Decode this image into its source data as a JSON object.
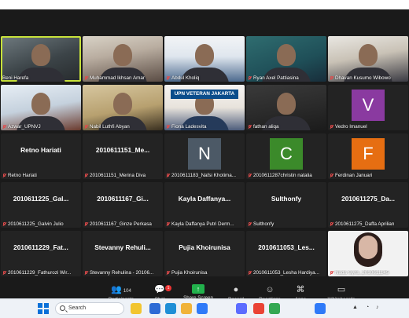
{
  "participants": [
    {
      "name": "Beni Harefa",
      "row": 0,
      "col": 0,
      "kind": "video",
      "style": "v1",
      "active": true,
      "muted": false
    },
    {
      "name": "Muhammad Ikhsan Amar",
      "row": 0,
      "col": 1,
      "kind": "video",
      "style": "v2",
      "muted": true
    },
    {
      "name": "Abdul Kholiq",
      "row": 0,
      "col": 2,
      "kind": "video",
      "style": "v3",
      "muted": true
    },
    {
      "name": "Ryan Axel Pattiasina",
      "row": 0,
      "col": 3,
      "kind": "video",
      "style": "v4",
      "muted": true
    },
    {
      "name": "Dhavan Kusumo Wibowo",
      "row": 0,
      "col": 4,
      "kind": "video",
      "style": "v5",
      "muted": true
    },
    {
      "name": "Azwar_UPNVJ",
      "row": 1,
      "col": 0,
      "kind": "video",
      "style": "v6",
      "muted": true
    },
    {
      "name": "Nabil Luthfi Abyan",
      "row": 1,
      "col": 1,
      "kind": "video",
      "style": "v7",
      "muted": true
    },
    {
      "name": "Fiona Ladesvita",
      "row": 1,
      "col": 2,
      "kind": "video",
      "style": "v8",
      "muted": true,
      "banner": "UPN VETERAN JAKARTA"
    },
    {
      "name": "fathan aliqa",
      "row": 1,
      "col": 3,
      "kind": "video",
      "style": "v9",
      "muted": true
    },
    {
      "name": "Vedro Imanuel",
      "row": 1,
      "col": 4,
      "kind": "avatar",
      "letter": "V",
      "color": "#8a3aa0",
      "muted": true
    },
    {
      "name": "Retno Hariati",
      "row": 2,
      "col": 0,
      "kind": "text",
      "big": "Retno Hariati",
      "muted": true
    },
    {
      "name": "2010611151_Merina Diva",
      "row": 2,
      "col": 1,
      "kind": "text",
      "big": "2010611151_Me...",
      "muted": true
    },
    {
      "name": "2010611183_Nafsi Khotima...",
      "row": 2,
      "col": 2,
      "kind": "avatar",
      "letter": "N",
      "color": "#4c5966",
      "muted": true
    },
    {
      "name": "2010611287christin natalia",
      "row": 2,
      "col": 3,
      "kind": "avatar",
      "letter": "C",
      "color": "#3b8a2a",
      "muted": true
    },
    {
      "name": "Ferdinan Januari",
      "row": 2,
      "col": 4,
      "kind": "avatar",
      "letter": "F",
      "color": "#e66e12",
      "muted": true
    },
    {
      "name": "2010611225_Galvin Julio",
      "row": 3,
      "col": 0,
      "kind": "text",
      "big": "2010611225_Gal...",
      "muted": true
    },
    {
      "name": "2010611167_Ginze Perkasa",
      "row": 3,
      "col": 1,
      "kind": "text",
      "big": "2010611167_Gi...",
      "muted": true
    },
    {
      "name": "Kayla Daffanya Putri Derm...",
      "row": 3,
      "col": 2,
      "kind": "text",
      "big": "Kayla Daffanya...",
      "muted": true
    },
    {
      "name": "Sulthonfy",
      "row": 3,
      "col": 3,
      "kind": "text",
      "big": "Sulthonfy",
      "muted": true
    },
    {
      "name": "2010611275_Daffa Aprilian",
      "row": 3,
      "col": 4,
      "kind": "text",
      "big": "2010611275_Da...",
      "muted": true
    },
    {
      "name": "2010611229_Fathurozi Wir...",
      "row": 4,
      "col": 0,
      "kind": "text",
      "big": "2010611229_Fat...",
      "muted": true
    },
    {
      "name": "Stevanny Rehulina - 20106...",
      "row": 4,
      "col": 1,
      "kind": "text",
      "big": "Stevanny Rehuli...",
      "muted": true
    },
    {
      "name": "Pujia Khoirunisa",
      "row": 4,
      "col": 2,
      "kind": "text",
      "big": "Pujia Khoirunisa",
      "muted": true
    },
    {
      "name": "2010611053_Lesha Hardiya...",
      "row": 4,
      "col": 3,
      "kind": "text",
      "big": "2010611053_Les...",
      "muted": true
    },
    {
      "name": "Nada Syifa_2010611145",
      "row": 4,
      "col": 4,
      "kind": "video",
      "style": "v10",
      "muted": true
    }
  ],
  "toolbar": [
    {
      "id": "participants",
      "label": "Participants",
      "icon": "participants-icon",
      "glyph": "👥",
      "count": "104"
    },
    {
      "id": "chat",
      "label": "Chat",
      "icon": "chat-icon",
      "glyph": "💬",
      "badge": "1"
    },
    {
      "id": "share",
      "label": "Share Screen",
      "icon": "share-screen-icon",
      "glyph": "↑"
    },
    {
      "id": "record",
      "label": "Record",
      "icon": "record-icon",
      "glyph": "●"
    },
    {
      "id": "reactions",
      "label": "Reactions",
      "icon": "reactions-icon",
      "glyph": "☺"
    },
    {
      "id": "apps",
      "label": "Apps",
      "icon": "apps-icon",
      "glyph": "⌘"
    },
    {
      "id": "whiteboards",
      "label": "Whiteboards",
      "icon": "whiteboards-icon",
      "glyph": "▭"
    }
  ],
  "taskbar": {
    "search_label": "Search",
    "apps": [
      {
        "name": "file-explorer-icon",
        "color": "#f2c530"
      },
      {
        "name": "store-icon",
        "color": "#2d6bd5"
      },
      {
        "name": "edge-icon",
        "color": "#1f8fd6"
      },
      {
        "name": "folder-icon",
        "color": "#f0b33a"
      },
      {
        "name": "zoom-icon",
        "color": "#2f7af8"
      },
      {
        "name": "app-icon",
        "color": "#5b6cff"
      },
      {
        "name": "chrome-icon",
        "color": "#ea4335"
      },
      {
        "name": "chrome-icon-2",
        "color": "#34a853"
      },
      {
        "name": "zoom-icon-2",
        "color": "#2f7af8"
      }
    ]
  }
}
